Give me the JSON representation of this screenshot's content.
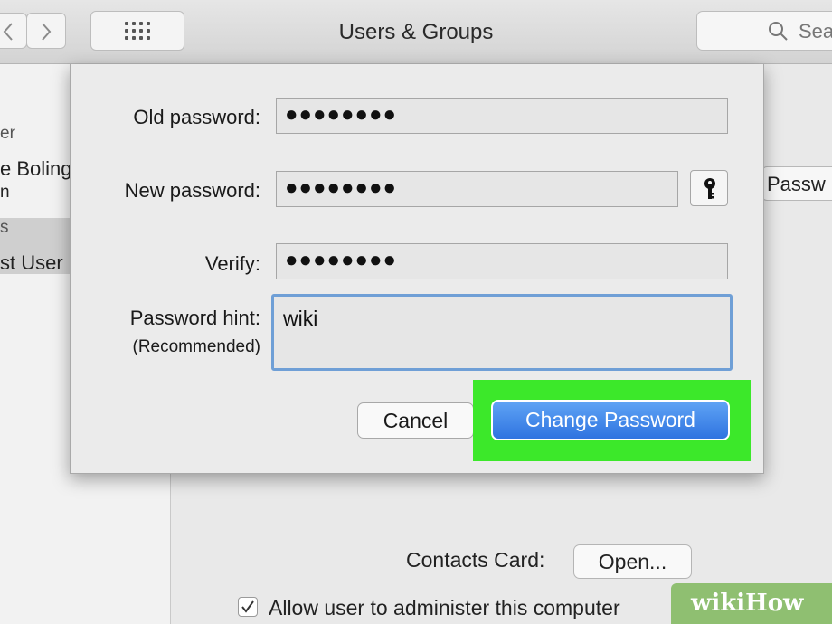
{
  "window": {
    "title": "Users & Groups",
    "search_placeholder": "Sea",
    "nav": [
      "back",
      "forward"
    ]
  },
  "sidebar": {
    "fragments": [
      "er",
      "e Boling",
      "n",
      "s",
      "st User"
    ]
  },
  "background": {
    "password_button_label": "Passw",
    "contacts_card_label": "Contacts Card:",
    "open_button_label": "Open...",
    "admin_checkbox_label": "Allow user to administer this computer",
    "admin_checked": true
  },
  "dialog": {
    "old_password_label": "Old password:",
    "old_password_value": "●●●●●●●●",
    "new_password_label": "New password:",
    "new_password_value": "●●●●●●●●",
    "verify_label": "Verify:",
    "verify_value": "●●●●●●●●",
    "hint_label": "Password hint:",
    "hint_sublabel": "(Recommended)",
    "hint_value": "wiki",
    "cancel_label": "Cancel",
    "change_label": "Change Password",
    "highlight_color": "#3ce82a",
    "primary_color": "#2f73e0"
  },
  "watermark": {
    "text": "wikiHow"
  }
}
